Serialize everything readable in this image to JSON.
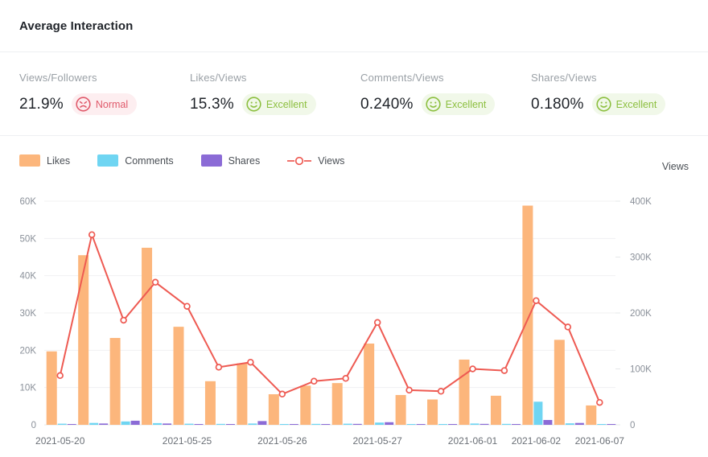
{
  "header": {
    "title": "Average Interaction"
  },
  "metrics": [
    {
      "label": "Views/Followers",
      "value": "21.9%",
      "badge": "Normal",
      "badge_kind": "normal",
      "face": "frown-icon"
    },
    {
      "label": "Likes/Views",
      "value": "15.3%",
      "badge": "Excellent",
      "badge_kind": "excellent",
      "face": "smile-icon"
    },
    {
      "label": "Comments/Views",
      "value": "0.240%",
      "badge": "Excellent",
      "badge_kind": "excellent",
      "face": "smile-icon"
    },
    {
      "label": "Shares/Views",
      "value": "0.180%",
      "badge": "Excellent",
      "badge_kind": "excellent",
      "face": "smile-icon"
    }
  ],
  "legend": {
    "items": [
      {
        "label": "Likes",
        "color": "#fcb67c",
        "marker": "square"
      },
      {
        "label": "Comments",
        "color": "#6fd5f2",
        "marker": "square"
      },
      {
        "label": "Shares",
        "color": "#8b6bd6",
        "marker": "square"
      },
      {
        "label": "Views",
        "color": "#ee5a52",
        "marker": "line-circle"
      }
    ]
  },
  "right_axis_title": "Views",
  "colors": {
    "likes": "#fcb67c",
    "comments": "#6fd5f2",
    "shares": "#8b6bd6",
    "views_line": "#ee5a52",
    "grid": "#f0f0f2",
    "axis_text": "#8a9099",
    "badge_normal_bg": "#fdeef0",
    "badge_normal_fg": "#e05a6b",
    "badge_excellent_bg": "#f1f8e9",
    "badge_excellent_fg": "#8cbf3f"
  },
  "chart_data": {
    "type": "bar",
    "title": "",
    "xlabel": "",
    "ylabel": "",
    "grid": true,
    "legend_position": "top-left",
    "x": [
      "2021-05-20",
      "",
      "",
      "",
      "2021-05-25",
      "",
      "",
      "2021-05-26",
      "",
      "",
      "2021-05-27",
      "",
      "",
      "2021-06-01",
      "",
      "2021-06-02",
      "",
      "2021-06-07"
    ],
    "x_tick_labels": [
      "2021-05-20",
      "2021-05-25",
      "2021-05-26",
      "2021-05-27",
      "2021-06-01",
      "2021-06-02",
      "2021-06-07"
    ],
    "x_tick_indices": [
      0,
      4,
      7,
      10,
      13,
      15,
      17
    ],
    "left_axis": {
      "ticks": [
        "0",
        "10K",
        "20K",
        "30K",
        "40K",
        "50K",
        "60K"
      ],
      "tick_values": [
        0,
        10000,
        20000,
        30000,
        40000,
        50000,
        60000
      ],
      "ylim": [
        0,
        60000
      ]
    },
    "right_axis": {
      "label": "Views",
      "ticks": [
        "0",
        "100K",
        "200K",
        "300K",
        "400K"
      ],
      "tick_values": [
        0,
        100000,
        200000,
        300000,
        400000
      ],
      "ylim": [
        0,
        400000
      ]
    },
    "series": [
      {
        "name": "Likes",
        "type": "bar",
        "axis": "left",
        "color": "#fcb67c",
        "values": [
          19700,
          45500,
          23300,
          47500,
          26300,
          11700,
          16500,
          8200,
          10500,
          11200,
          21800,
          8000,
          6800,
          17500,
          7800,
          58800,
          22800,
          5200
        ]
      },
      {
        "name": "Comments",
        "type": "bar",
        "axis": "left",
        "color": "#6fd5f2",
        "values": [
          300,
          500,
          900,
          450,
          300,
          250,
          350,
          200,
          250,
          300,
          600,
          200,
          200,
          350,
          250,
          6200,
          400,
          150
        ]
      },
      {
        "name": "Shares",
        "type": "bar",
        "axis": "left",
        "color": "#8b6bd6",
        "values": [
          200,
          350,
          1100,
          350,
          200,
          150,
          1000,
          150,
          200,
          250,
          700,
          150,
          150,
          250,
          150,
          1300,
          500,
          100
        ]
      },
      {
        "name": "Views",
        "type": "line",
        "axis": "right",
        "color": "#ee5a52",
        "values": [
          88000,
          340000,
          187000,
          255000,
          212000,
          103000,
          112000,
          55000,
          78000,
          83000,
          183000,
          62000,
          60000,
          100000,
          97000,
          222000,
          175000,
          40000
        ]
      }
    ]
  }
}
